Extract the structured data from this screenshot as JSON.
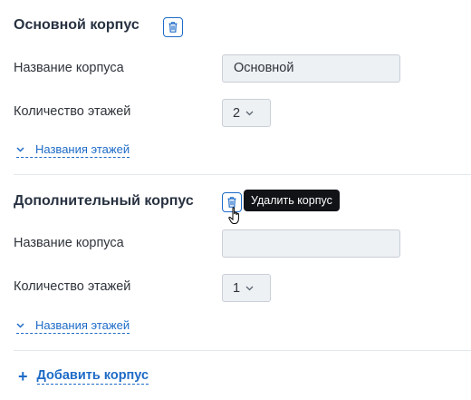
{
  "buildings": [
    {
      "title": "Основной корпус",
      "name_label": "Название корпуса",
      "name_value": "Основной",
      "floors_label": "Количество этажей",
      "floors_value": "2",
      "floor_names_link": "Названия этажей"
    },
    {
      "title": "Дополнительный корпус",
      "name_label": "Название корпуса",
      "name_value": "",
      "floors_label": "Количество этажей",
      "floors_value": "1",
      "floor_names_link": "Названия этажей"
    }
  ],
  "tooltip": "Удалить корпус",
  "add_building_label": "Добавить корпус",
  "plus_icon": "+",
  "colors": {
    "accent": "#1e6bc7",
    "input_bg": "#eef1f4",
    "tooltip_bg": "#111317"
  },
  "icons": [
    "trash-icon",
    "chevron-down-icon",
    "hand-cursor-icon",
    "plus-icon"
  ]
}
